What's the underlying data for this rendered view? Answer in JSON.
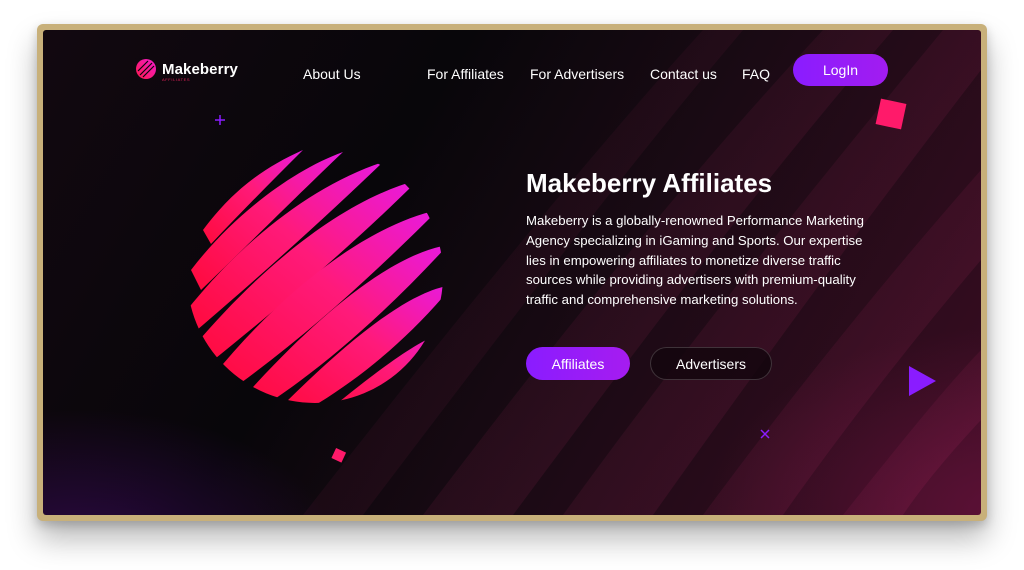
{
  "brand": {
    "name": "Makeberry",
    "sub": "AFFILIATES"
  },
  "nav": {
    "items": [
      {
        "label": "About Us"
      },
      {
        "label": "For Affiliates"
      },
      {
        "label": "For Advertisers"
      },
      {
        "label": "Contact us"
      },
      {
        "label": "FAQ"
      }
    ],
    "login_label": "LogIn"
  },
  "hero": {
    "title": "Makeberry Affiliates",
    "description": "Makeberry is a globally-renowned Performance Marketing Agency specializing in iGaming and Sports. Our expertise lies in empowering affiliates to monetize diverse traffic sources while providing advertisers with premium-quality traffic and comprehensive marketing solutions.",
    "primary_button": "Affiliates",
    "secondary_button": "Advertisers"
  },
  "colors": {
    "accent_purple": "#8a1cff",
    "brand_pink": "#ff1a6e",
    "brand_magenta": "#f21ad0",
    "background": "#08060a"
  },
  "icons": {
    "logo": "makeberry-logo-icon",
    "hero_graphic": "striped-sphere-icon",
    "decorations": [
      "pink-square-icon",
      "purple-triangle-icon",
      "plus-icon",
      "cross-icon",
      "small-pink-diamond-icon"
    ]
  }
}
